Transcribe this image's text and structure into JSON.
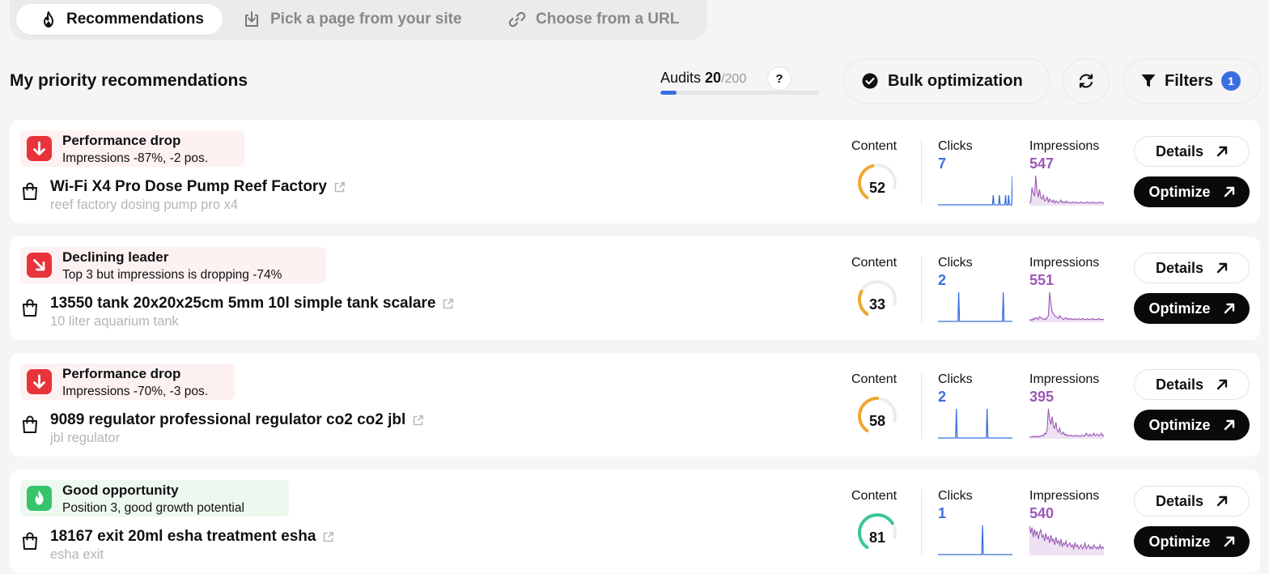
{
  "tabs": [
    {
      "label": "Recommendations",
      "icon": "flame-icon",
      "active": true
    },
    {
      "label": "Pick a page from your site",
      "icon": "download-page-icon",
      "active": false
    },
    {
      "label": "Choose from a URL",
      "icon": "link-icon",
      "active": false
    }
  ],
  "header": {
    "title": "My priority recommendations",
    "audits_label": "Audits",
    "audits_used": "20",
    "audits_total": "/200",
    "audits_fraction": 0.1,
    "help_label": "?",
    "bulk_label": "Bulk optimization",
    "filters_label": "Filters",
    "filters_count": "1"
  },
  "labels": {
    "content": "Content",
    "clicks": "Clicks",
    "impressions": "Impressions",
    "details": "Details",
    "optimize": "Optimize"
  },
  "colors": {
    "accent_blue": "#3b6fe0",
    "impressions_purple": "#9b59b6",
    "alert_red": "#e8333a",
    "success_green": "#35c46a",
    "gauge_orange": "#f0a830",
    "gauge_green": "#3cc49a"
  },
  "recommendations": [
    {
      "type": "Performance drop",
      "tone": "red",
      "icon": "arrow-down-icon",
      "description": "Impressions -87%, -2 pos.",
      "page": "Wi-Fi X4 Pro Dose Pump Reef Factory",
      "keyword": "reef factory dosing pump pro x4",
      "content_score": "52",
      "clicks": "7",
      "impressions": "547",
      "clicks_series": [
        0,
        0,
        0,
        0,
        0,
        0,
        0,
        0,
        0,
        0,
        0,
        0,
        0,
        0,
        0,
        0,
        0,
        0,
        0,
        0,
        0,
        0,
        0,
        0,
        0,
        0,
        0,
        0,
        0,
        0,
        0,
        0,
        0,
        0,
        0,
        0,
        0,
        0,
        0,
        0,
        0,
        0,
        0,
        0,
        0,
        0,
        0,
        0,
        0,
        0,
        0,
        0,
        0,
        0,
        0,
        0,
        0,
        0,
        0,
        0,
        0,
        0,
        0,
        0,
        0,
        0,
        0,
        0,
        0,
        0,
        0,
        0,
        1,
        0,
        0,
        0,
        0,
        0,
        0,
        0,
        1,
        0,
        0,
        0,
        0,
        0,
        0,
        0,
        1,
        0,
        0,
        0,
        1,
        0,
        0,
        0,
        0,
        3
      ],
      "impr_series": [
        2,
        3,
        18,
        12,
        9,
        30,
        14,
        8,
        16,
        7,
        6,
        10,
        4,
        5,
        8,
        3,
        6,
        4,
        3,
        5,
        2,
        4,
        3,
        2,
        3,
        5,
        2,
        3,
        2,
        4,
        2,
        3,
        2,
        2,
        3,
        2,
        2,
        3,
        2,
        2,
        2,
        3,
        2,
        2,
        2,
        2,
        3,
        2,
        2,
        2,
        3,
        2,
        2,
        2,
        2,
        2,
        3,
        2,
        2,
        2
      ]
    },
    {
      "type": "Declining leader",
      "tone": "red",
      "icon": "arrow-down-right-icon",
      "description": "Top 3 but impressions is dropping -74%",
      "page": "13550 tank 20x20x25cm 5mm 10l simple tank scalare",
      "keyword": "10 liter aquarium tank",
      "content_score": "33",
      "clicks": "2",
      "impressions": "551",
      "clicks_series": [
        0,
        0,
        0,
        0,
        0,
        0,
        0,
        0,
        0,
        0,
        0,
        0,
        0,
        0,
        0,
        0,
        0,
        0,
        0,
        0,
        0,
        0,
        0,
        0,
        0,
        0,
        0,
        1,
        0,
        0,
        0,
        0,
        0,
        0,
        0,
        0,
        0,
        0,
        0,
        0,
        0,
        0,
        0,
        0,
        0,
        0,
        0,
        0,
        0,
        0,
        0,
        0,
        0,
        0,
        0,
        0,
        0,
        0,
        0,
        0,
        0,
        0,
        0,
        0,
        0,
        0,
        0,
        0,
        0,
        0,
        0,
        0,
        0,
        0,
        0,
        0,
        0,
        0,
        0,
        0,
        0,
        0,
        0,
        0,
        0,
        1,
        0,
        0,
        0,
        0,
        0,
        0,
        0,
        0,
        0,
        0,
        0,
        0
      ],
      "impr_series": [
        1,
        2,
        1,
        3,
        2,
        4,
        3,
        2,
        5,
        4,
        3,
        2,
        3,
        2,
        4,
        6,
        30,
        18,
        10,
        8,
        6,
        5,
        4,
        3,
        6,
        4,
        3,
        2,
        3,
        4,
        2,
        3,
        2,
        3,
        2,
        2,
        3,
        2,
        2,
        3,
        2,
        2,
        3,
        2,
        2,
        2,
        3,
        2,
        2,
        2,
        3,
        2,
        2,
        2,
        2,
        3,
        2,
        2,
        2,
        2
      ]
    },
    {
      "type": "Performance drop",
      "tone": "red",
      "icon": "arrow-down-icon",
      "description": "Impressions -70%, -3 pos.",
      "page": "9089 regulator professional regulator co2 co2 jbl",
      "keyword": "jbl regulator",
      "content_score": "58",
      "clicks": "2",
      "impressions": "395",
      "clicks_series": [
        0,
        0,
        0,
        0,
        0,
        0,
        0,
        0,
        0,
        0,
        0,
        0,
        0,
        0,
        0,
        0,
        0,
        0,
        0,
        0,
        0,
        0,
        0,
        0,
        1,
        0,
        0,
        0,
        0,
        0,
        0,
        0,
        0,
        0,
        0,
        0,
        0,
        0,
        0,
        0,
        0,
        0,
        0,
        0,
        0,
        0,
        0,
        0,
        0,
        0,
        0,
        0,
        0,
        0,
        0,
        0,
        0,
        0,
        0,
        0,
        0,
        0,
        0,
        0,
        1,
        0,
        0,
        0,
        0,
        0,
        0,
        0,
        0,
        0,
        0,
        0,
        0,
        0,
        0,
        0,
        0,
        0,
        0,
        0,
        0,
        0,
        0,
        0,
        0,
        0,
        0,
        0,
        0,
        0,
        0,
        0,
        0,
        0
      ],
      "impr_series": [
        1,
        1,
        1,
        2,
        1,
        2,
        1,
        2,
        1,
        2,
        3,
        2,
        5,
        4,
        8,
        30,
        20,
        14,
        22,
        12,
        10,
        16,
        8,
        6,
        10,
        5,
        4,
        6,
        3,
        4,
        2,
        3,
        2,
        3,
        2,
        2,
        2,
        3,
        2,
        2,
        2,
        2,
        3,
        2,
        2,
        5,
        3,
        2,
        4,
        2,
        3,
        5,
        2,
        3,
        4,
        2,
        3,
        5,
        2,
        3
      ]
    },
    {
      "type": "Good opportunity",
      "tone": "green",
      "icon": "flame-icon",
      "description": "Position 3, good growth potential",
      "page": "18167 exit 20ml esha treatment esha",
      "keyword": "esha exit",
      "content_score": "81",
      "clicks": "1",
      "impressions": "540",
      "clicks_series": [
        0,
        0,
        0,
        0,
        0,
        0,
        0,
        0,
        0,
        0,
        0,
        0,
        0,
        0,
        0,
        0,
        0,
        0,
        0,
        0,
        0,
        0,
        0,
        0,
        0,
        0,
        0,
        0,
        0,
        0,
        0,
        0,
        0,
        0,
        0,
        0,
        0,
        0,
        0,
        0,
        0,
        0,
        0,
        0,
        0,
        0,
        0,
        0,
        0,
        0,
        0,
        0,
        0,
        0,
        0,
        0,
        0,
        0,
        1,
        0,
        0,
        0,
        0,
        0,
        0,
        0,
        0,
        0,
        0,
        0,
        0,
        0,
        0,
        0,
        0,
        0,
        0,
        0,
        0,
        0,
        0,
        0,
        0,
        0,
        0,
        0,
        0,
        0,
        0,
        0,
        0,
        0,
        0,
        0,
        0,
        0,
        0,
        0
      ],
      "impr_series": [
        30,
        22,
        28,
        18,
        26,
        20,
        24,
        16,
        22,
        26,
        18,
        20,
        14,
        22,
        16,
        18,
        12,
        20,
        14,
        16,
        10,
        18,
        12,
        14,
        10,
        16,
        8,
        12,
        10,
        14,
        8,
        10,
        12,
        8,
        10,
        6,
        12,
        8,
        10,
        6,
        8,
        10,
        6,
        8,
        12,
        6,
        8,
        10,
        6,
        8,
        6,
        10,
        8,
        6,
        8,
        6,
        10,
        6,
        8,
        6
      ]
    }
  ]
}
